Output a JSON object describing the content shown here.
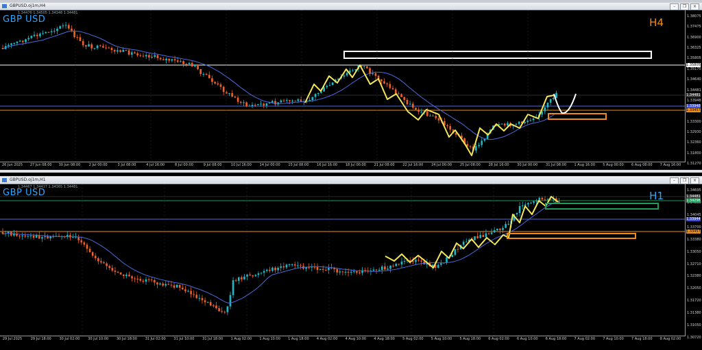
{
  "h4": {
    "window_title": "GBPUSD.oj1m,H4",
    "symbol": "GBP USD",
    "timeframe": "H4",
    "ohlc": "1.34476 1.34505 1.34348 1.34481",
    "tf_color": "#f08c1e",
    "price_labels": [
      "1.38075",
      "1.37475",
      "1.36900",
      "1.36325",
      "1.35805",
      "1.35175",
      "1.34640",
      "1.34481",
      "1.33948",
      "1.33457",
      "1.33300",
      "1.32930",
      "1.32360",
      "1.31800",
      "1.31270"
    ],
    "tags": [
      {
        "text": "1.35805",
        "color": "#ffffff",
        "text_color": "#000000"
      },
      {
        "text": "1.34481",
        "color": "#3c3c3c",
        "text_color": "#ffffff"
      },
      {
        "text": "1.33948",
        "color": "#3e4fd1",
        "text_color": "#ffffff"
      },
      {
        "text": "1.33457",
        "color": "#f08c1e",
        "text_color": "#000000"
      }
    ],
    "time_labels": [
      "26 Jun 2025",
      "27 Jun 08:00",
      "30 Jun 08:00",
      "2 Jul 00:00",
      "3 Jul 08:00",
      "4 Jul 16:00",
      "8 Jul 00:00",
      "9 Jul 08:00",
      "10 Jul 16:00",
      "14 Jul 00:00",
      "15 Jul 08:00",
      "16 Jul 16:00",
      "18 Jul 00:00",
      "21 Jul 08:00",
      "22 Jul 16:00",
      "24 Jul 00:00",
      "25 Jul 08:00",
      "28 Jul 16:00",
      "30 Jul 00:00",
      "31 Jul 08:00",
      "1 Aug 16:00",
      "5 Aug 00:00",
      "6 Aug 08:00",
      "7 Aug 16:00"
    ]
  },
  "h1": {
    "window_title": "GBPUSD.oj1m,H1",
    "symbol": "GBP USD",
    "timeframe": "H1",
    "ohlc": "1.34467 1.34417 1.34365 1.34481",
    "tf_color": "#2ea6ff",
    "price_labels": [
      "1.34695",
      "1.34300",
      "1.34045",
      "1.33700",
      "1.33380",
      "1.33050",
      "1.32710",
      "1.32380",
      "1.32050",
      "1.31720",
      "1.31380",
      "1.31050",
      "1.30720"
    ],
    "tags": [
      {
        "text": "1.34481",
        "color": "#3c3c3c",
        "text_color": "#ffffff"
      },
      {
        "text": "1.34296",
        "color": "#1e9e5a",
        "text_color": "#ffffff"
      },
      {
        "text": "1.33944",
        "color": "#3e4fd1",
        "text_color": "#ffffff"
      },
      {
        "text": "1.33457",
        "color": "#f08c1e",
        "text_color": "#000000"
      }
    ],
    "time_labels": [
      "29 Jul 2025",
      "29 Jul 18:00",
      "30 Jul 02:00",
      "30 Jul 10:00",
      "30 Jul 18:00",
      "31 Jul 02:00",
      "31 Jul 10:00",
      "31 Jul 18:00",
      "1 Aug 02:00",
      "1 Aug 10:00",
      "1 Aug 18:00",
      "4 Aug 02:00",
      "4 Aug 10:00",
      "4 Aug 18:00",
      "5 Aug 02:00",
      "5 Aug 10:00",
      "5 Aug 18:00",
      "6 Aug 02:00",
      "6 Aug 10:00",
      "6 Aug 18:00",
      "7 Aug 02:00",
      "7 Aug 10:00",
      "7 Aug 18:00",
      "8 Aug 02:00"
    ]
  },
  "colors": {
    "bull": "#1fb8c8",
    "bear": "#f0602a",
    "ma": "#4a6be0",
    "zigzag": "#f5e65a",
    "zone_orange": "#f08c1e",
    "zone_green": "#1e9e5a"
  }
}
